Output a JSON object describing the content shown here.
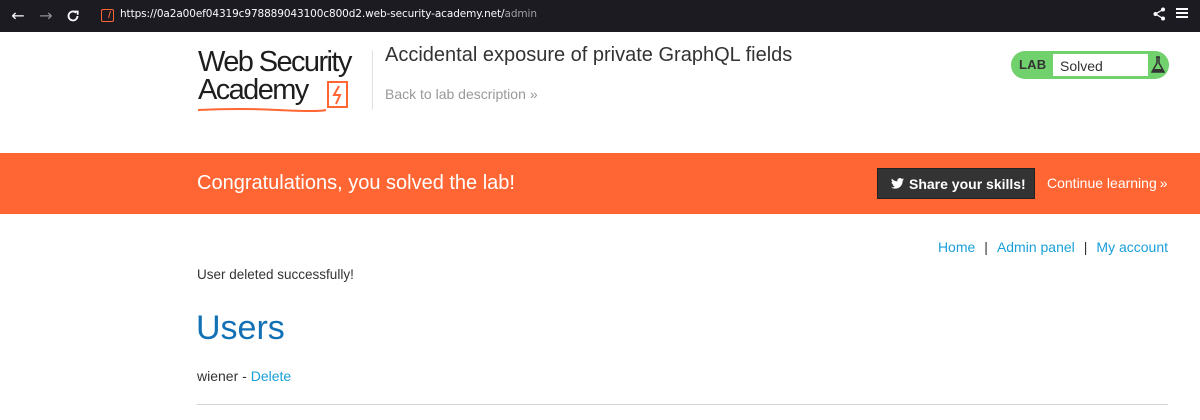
{
  "browser": {
    "url_main": "https://0a2a00ef04319c978889043100c800d2.web-security-academy.net/",
    "url_path": "admin",
    "back_icon": "arrow-left-icon",
    "forward_icon": "arrow-right-icon",
    "reload_icon": "reload-icon",
    "share_icon": "share-icon",
    "menu_icon": "menu-icon"
  },
  "header": {
    "logo_line1": "Web Security",
    "logo_line2": "Academy",
    "lab_title": "Accidental exposure of private GraphQL fields",
    "back_link": "Back to lab description",
    "back_chevron": "»",
    "badge_label": "LAB",
    "badge_status": "Solved",
    "badge_icon": "flask-icon"
  },
  "banner": {
    "message": "Congratulations, you solved the lab!",
    "share_label": "Share your skills!",
    "share_icon": "twitter-icon",
    "continue_label": "Continue learning",
    "continue_chevron": "»"
  },
  "nav": {
    "home": "Home",
    "separator": "|",
    "admin": "Admin panel",
    "account": "My account"
  },
  "main": {
    "status_message": "User deleted successfully!",
    "heading": "Users",
    "users": [
      {
        "name": "wiener",
        "separator": " - ",
        "action": "Delete"
      }
    ]
  },
  "colors": {
    "accent": "#ff6633",
    "link": "#1a9fd9",
    "heading": "#1271b5",
    "badge_green": "#70d16d"
  }
}
